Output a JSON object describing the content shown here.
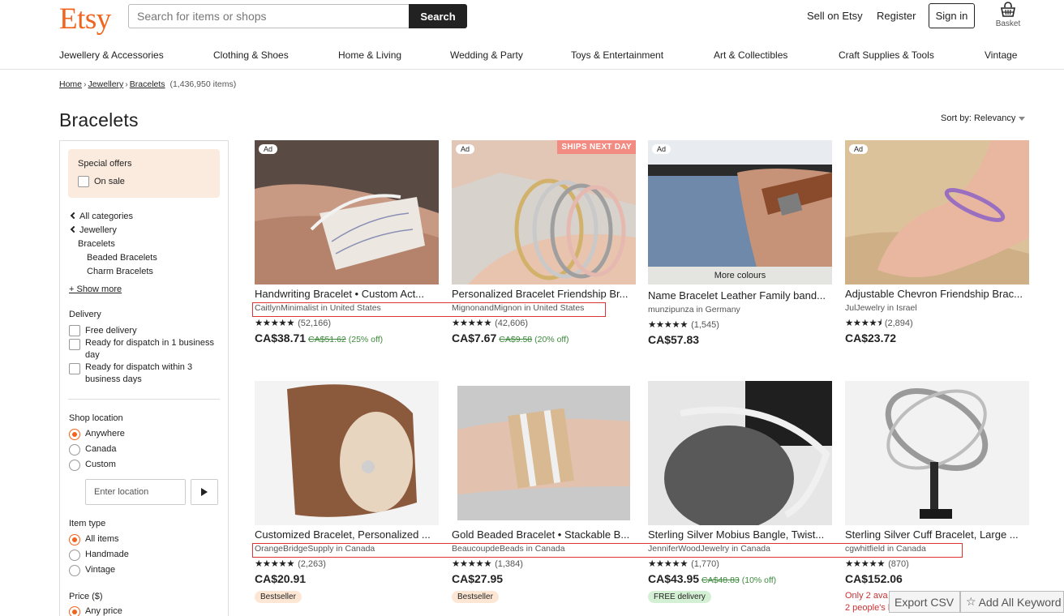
{
  "header": {
    "logo": "Etsy",
    "search_placeholder": "Search for items or shops",
    "search_button": "Search",
    "sell": "Sell on Etsy",
    "register": "Register",
    "signin": "Sign in",
    "basket": "Basket"
  },
  "categories": [
    "Jewellery & Accessories",
    "Clothing & Shoes",
    "Home & Living",
    "Wedding & Party",
    "Toys & Entertainment",
    "Art & Collectibles",
    "Craft Supplies & Tools",
    "Vintage"
  ],
  "breadcrumb": {
    "home": "Home",
    "jewellery": "Jewellery",
    "bracelets": "Bracelets",
    "count": "(1,436,950 items)"
  },
  "page_title": "Bracelets",
  "sort": {
    "label": "Sort by:",
    "value": "Relevancy"
  },
  "sidebar": {
    "special_offers": "Special offers",
    "on_sale": "On sale",
    "all_categories": "All categories",
    "jewellery": "Jewellery",
    "bracelets": "Bracelets",
    "beaded": "Beaded Bracelets",
    "charm": "Charm Bracelets",
    "show_more": "+ Show more",
    "delivery": "Delivery",
    "free_delivery": "Free delivery",
    "dispatch_1": "Ready for dispatch in 1 business day",
    "dispatch_3": "Ready for dispatch within 3 business days",
    "shop_location": "Shop location",
    "anywhere": "Anywhere",
    "canada": "Canada",
    "custom": "Custom",
    "location_placeholder": "Enter location",
    "item_type": "Item type",
    "all_items": "All items",
    "handmade": "Handmade",
    "vintage": "Vintage",
    "price": "Price ($)",
    "any_price": "Any price"
  },
  "products": [
    {
      "title": "Handwriting Bracelet • Custom Act...",
      "shop": "CaitlynMinimalist in United States",
      "stars": "★★★★★",
      "reviews": "(52,166)",
      "price": "CA$38.71",
      "was": "CA$51.62",
      "off": "(25% off)",
      "ad": "Ad"
    },
    {
      "title": "Personalized Bracelet Friendship Br...",
      "shop": "MignonandMignon in United States",
      "stars": "★★★★★",
      "reviews": "(42,606)",
      "price": "CA$7.67",
      "was": "CA$9.58",
      "off": "(20% off)",
      "ad": "Ad",
      "ships": "SHIPS NEXT DAY"
    },
    {
      "title": "Name Bracelet Leather Family band...",
      "shop": "munzipunza in Germany",
      "stars": "★★★★★",
      "reviews": "(1,545)",
      "price": "CA$57.83",
      "ad": "Ad",
      "more": "More colours"
    },
    {
      "title": "Adjustable Chevron Friendship Brac...",
      "shop": "JulJewelry in Israel",
      "stars": "★★★★⯨",
      "reviews": "(2,894)",
      "price": "CA$23.72",
      "ad": "Ad"
    },
    {
      "title": "Customized Bracelet, Personalized ...",
      "shop": "OrangeBridgeSupply in Canada",
      "stars": "★★★★★",
      "reviews": "(2,263)",
      "price": "CA$20.91",
      "pill": "Bestseller"
    },
    {
      "title": "Gold Beaded Bracelet • Stackable B...",
      "shop": "BeaucoupdeBeads in Canada",
      "stars": "★★★★★",
      "reviews": "(1,384)",
      "price": "CA$27.95",
      "pill": "Bestseller"
    },
    {
      "title": "Sterling Silver Mobius Bangle, Twist...",
      "shop": "JenniferWoodJewelry in Canada",
      "stars": "★★★★★",
      "reviews": "(1,770)",
      "price": "CA$43.95",
      "was": "CA$48.83",
      "off": "(10% off)",
      "pill": "FREE delivery"
    },
    {
      "title": "Sterling Silver Cuff Bracelet, Large ...",
      "shop": "cgwhitfield in Canada",
      "stars": "★★★★★",
      "reviews": "(870)",
      "price": "CA$152.06",
      "urgent1": "Only 2 ava",
      "urgent2": "2 people's baskets"
    }
  ],
  "overlay": {
    "export": "Export CSV",
    "add_keywords": "Add All Keyword"
  },
  "colors": {
    "accent": "#f1641e",
    "sale_green": "#3c8a3c",
    "highlight_box": "#dd3333"
  }
}
